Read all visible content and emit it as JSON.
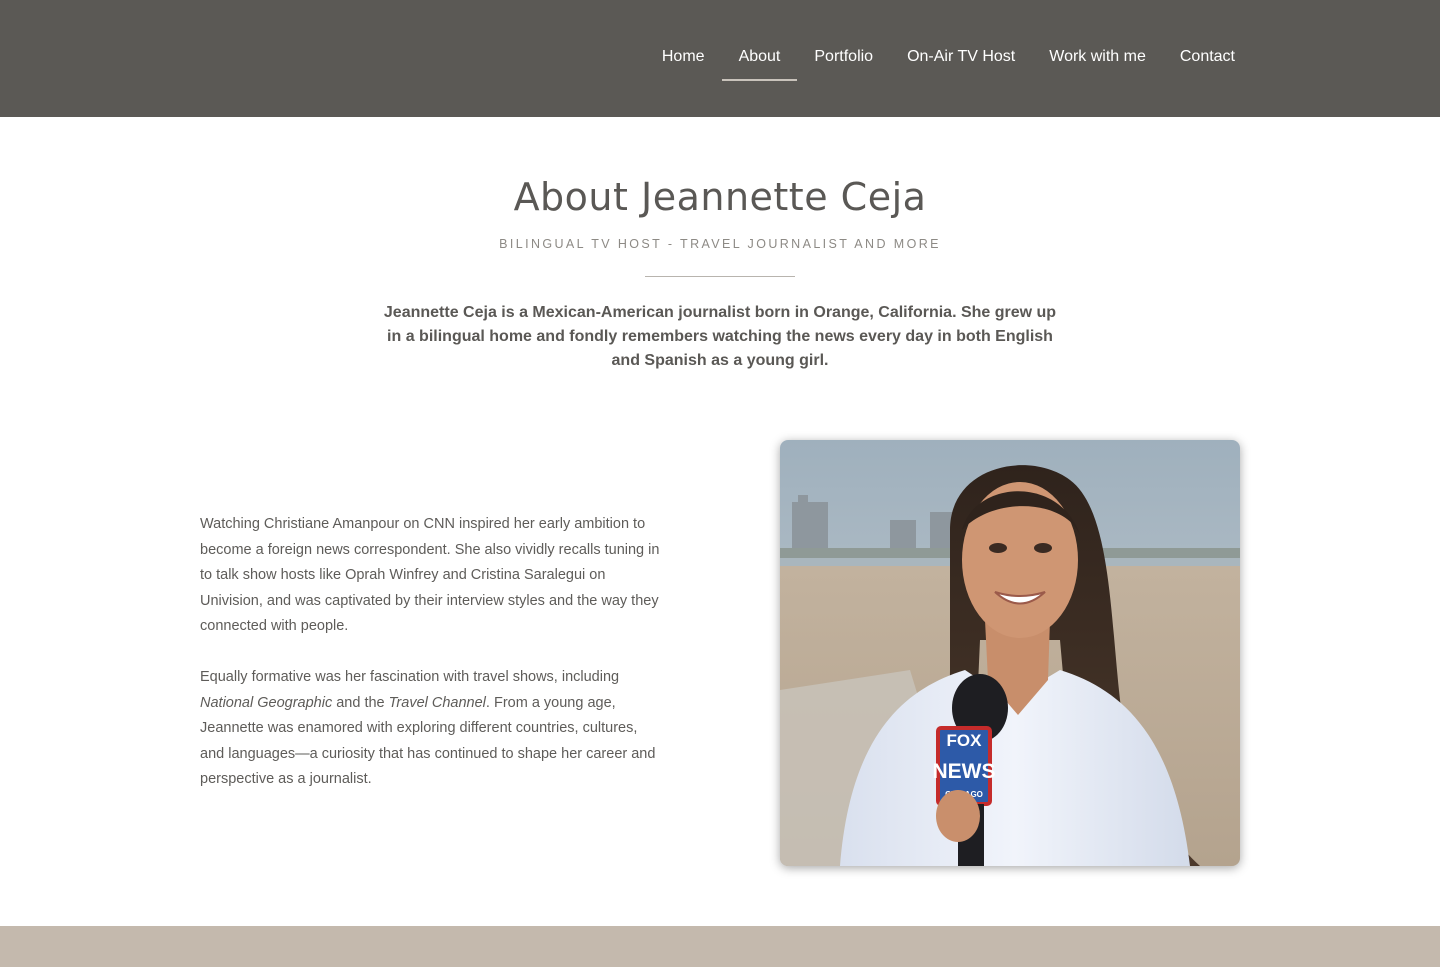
{
  "nav": {
    "items": [
      {
        "label": "Home",
        "active": false
      },
      {
        "label": "About",
        "active": true
      },
      {
        "label": "Portfolio",
        "active": false
      },
      {
        "label": "On-Air TV Host",
        "active": false
      },
      {
        "label": "Work with me",
        "active": false
      },
      {
        "label": "Contact",
        "active": false
      }
    ]
  },
  "intro": {
    "title": "About Jeannette Ceja",
    "subtitle": "BILINGUAL TV HOST - TRAVEL JOURNALIST AND MORE",
    "lead": "Jeannette Ceja is a Mexican-American journalist born in Orange, California. She grew up in a bilingual home and fondly remembers watching the news every day in both English and Spanish as a young girl."
  },
  "body": {
    "paragraph1": "Watching Christiane Amanpour on CNN inspired her early ambition to become a foreign news correspondent. She also vividly recalls tuning in to talk show hosts like Oprah Winfrey and Cristina Saralegui on Univision, and was captivated by their interview styles and the way they connected with people.",
    "p2_part1": "Equally formative was her fascination with travel shows, including ",
    "p2_em1": "National Geographic",
    "p2_part2": " and the ",
    "p2_em2": "Travel Channel",
    "p2_part3": ". From a young age, Jeannette was enamored with exploring different countries, cultures, and languages—a curiosity that has continued to shape her career and perspective as a journalist."
  },
  "photo": {
    "mic_brand_top": "FOX",
    "mic_brand_mid": "NEWS",
    "mic_brand_bottom": "CHICAGO"
  },
  "colors": {
    "header_bg": "#5b5955",
    "footer_band": "#c4b9ad",
    "active_underline": "#c9c3bb"
  }
}
